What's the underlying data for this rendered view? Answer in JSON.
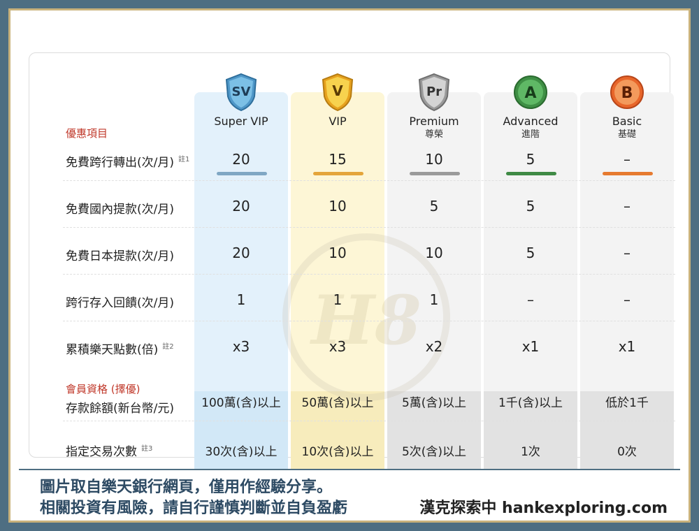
{
  "header": {
    "section_label": "優惠項目"
  },
  "tiers": [
    {
      "key": "sv",
      "badge": "SV",
      "name": "Super VIP",
      "sub": "",
      "color": "#5b8fb1",
      "bar_color": "#7fa7c4"
    },
    {
      "key": "v",
      "badge": "V",
      "name": "VIP",
      "sub": "",
      "color": "#e0a92a",
      "bar_color": "#e4a53a"
    },
    {
      "key": "pr",
      "badge": "Pr",
      "name": "Premium",
      "sub": "尊榮",
      "color": "#8f8f8f",
      "bar_color": "#9a9a9a"
    },
    {
      "key": "a",
      "badge": "A",
      "name": "Advanced",
      "sub": "進階",
      "color": "#3f8f45",
      "bar_color": "#3f8a45"
    },
    {
      "key": "b",
      "badge": "B",
      "name": "Basic",
      "sub": "基礎",
      "color": "#e8662a",
      "bar_color": "#e67a30"
    }
  ],
  "benefit_rows": [
    {
      "label": "免費跨行轉出(次/月)",
      "note": "註1",
      "values": [
        "20",
        "15",
        "10",
        "5",
        "–"
      ]
    },
    {
      "label": "免費國內提款(次/月)",
      "note": "",
      "values": [
        "20",
        "10",
        "5",
        "5",
        "–"
      ]
    },
    {
      "label": "免費日本提款(次/月)",
      "note": "",
      "values": [
        "20",
        "10",
        "10",
        "5",
        "–"
      ]
    },
    {
      "label": "跨行存入回饋(次/月)",
      "note": "",
      "values": [
        "1",
        "1",
        "1",
        "–",
        "–"
      ]
    },
    {
      "label": "累積樂天點數(倍)",
      "note": "註2",
      "values": [
        "x3",
        "x3",
        "x2",
        "x1",
        "x1"
      ]
    }
  ],
  "membership": {
    "section_label": "會員資格 (擇優)",
    "rows": [
      {
        "label": "存款餘額(新台幣/元)",
        "note": "",
        "values": [
          "100萬(含)以上",
          "50萬(含)以上",
          "5萬(含)以上",
          "1千(含)以上",
          "低於1千"
        ]
      },
      {
        "label": "指定交易次數",
        "note": "註3",
        "values": [
          "30次(含)以上",
          "10次(含)以上",
          "5次(含)以上",
          "1次",
          "0次"
        ]
      }
    ]
  },
  "watermark": {
    "text": "H8"
  },
  "footer": {
    "line1": "圖片取自樂天銀行網頁，僅用作經驗分享。",
    "line2": "相關投資有風險，請自行謹慎判斷並自負盈虧",
    "brand": "漢克探索中 hankexploring.com"
  }
}
